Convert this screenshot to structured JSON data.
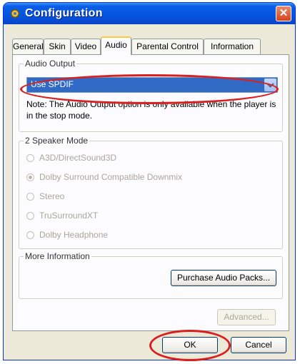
{
  "window": {
    "title": "Configuration",
    "close_label": "✕"
  },
  "tabs": [
    "General",
    "Skin",
    "Video",
    "Audio",
    "Parental Control",
    "Information"
  ],
  "active_tab": "Audio",
  "audio_output": {
    "group_label": "Audio Output",
    "selected": "Use SPDIF",
    "note": "Note:  The Audio Output option is only available when the player is in the stop mode."
  },
  "speaker_mode": {
    "group_label": "2 Speaker Mode",
    "options": [
      "A3D/DirectSound3D",
      "Dolby Surround Compatible Downmix",
      "Stereo",
      "TruSurroundXT",
      "Dolby Headphone"
    ],
    "selected_index": 1
  },
  "more_info": {
    "group_label": "More Information",
    "purchase_label": "Purchase Audio Packs..."
  },
  "advanced_label": "Advanced...",
  "ok_label": "OK",
  "cancel_label": "Cancel",
  "colors": {
    "title_bar": "#0554e0",
    "selection": "#316ac5",
    "highlight_ring": "#d92020",
    "dialog_face": "#ece9d8"
  }
}
